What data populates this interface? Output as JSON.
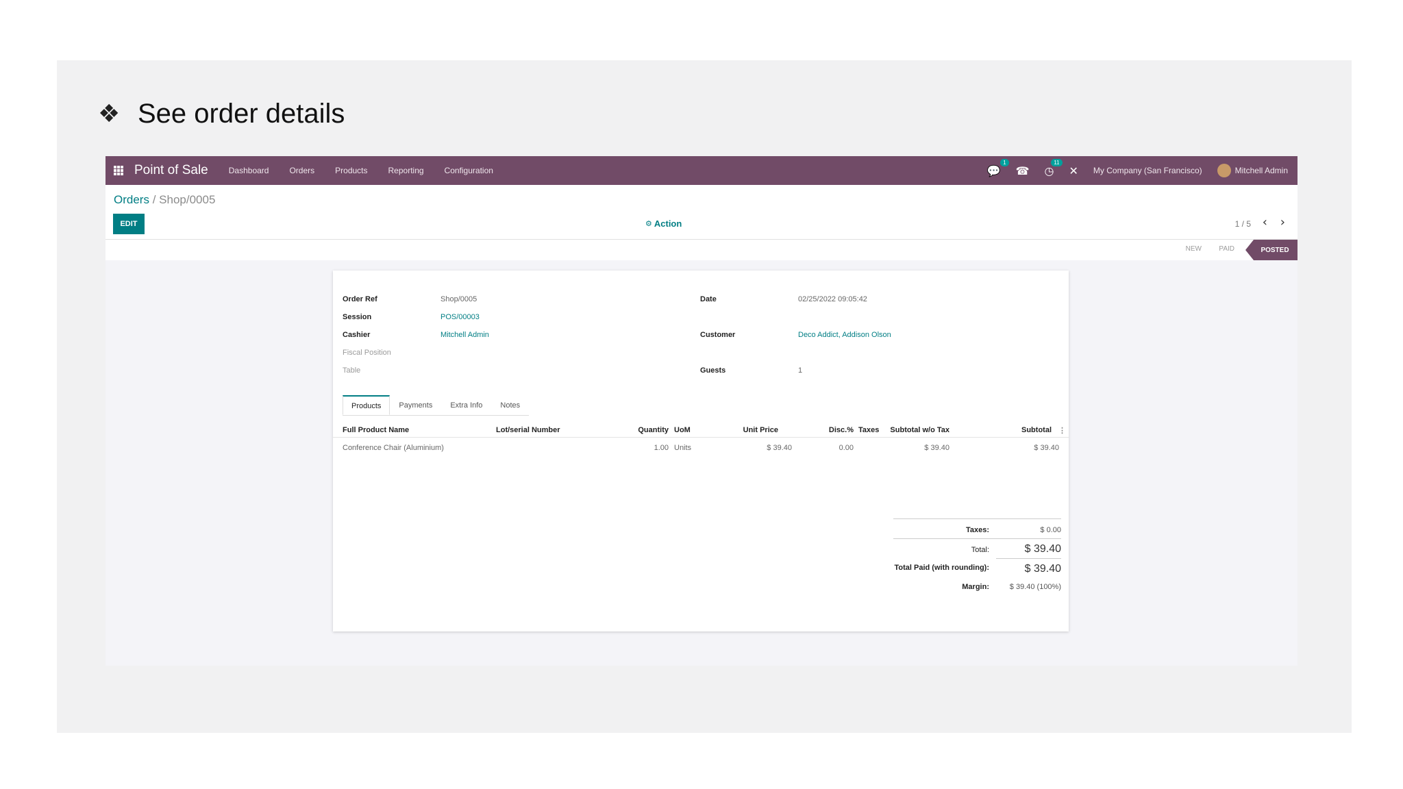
{
  "slide": {
    "bullet": "❖",
    "heading": "See order details"
  },
  "navbar": {
    "app_name": "Point of Sale",
    "menu": [
      "Dashboard",
      "Orders",
      "Products",
      "Reporting",
      "Configuration"
    ],
    "chat_badge": "1",
    "activity_badge": "11",
    "company": "My Company (San Francisco)",
    "user": "Mitchell Admin"
  },
  "breadcrumb": {
    "parent": "Orders",
    "separator": "/",
    "current": "Shop/0005"
  },
  "toolbar": {
    "edit": "EDIT",
    "action": "Action",
    "pager": "1 / 5"
  },
  "status": {
    "steps": [
      "NEW",
      "PAID"
    ],
    "current": "POSTED"
  },
  "form": {
    "order_ref_label": "Order Ref",
    "order_ref": "Shop/0005",
    "session_label": "Session",
    "session": "POS/00003",
    "cashier_label": "Cashier",
    "cashier": "Mitchell Admin",
    "fiscal_label": "Fiscal Position",
    "table_label": "Table",
    "date_label": "Date",
    "date": "02/25/2022 09:05:42",
    "customer_label": "Customer",
    "customer": "Deco Addict, Addison Olson",
    "guests_label": "Guests",
    "guests": "1"
  },
  "tabs": [
    "Products",
    "Payments",
    "Extra Info",
    "Notes"
  ],
  "table": {
    "columns": [
      "Full Product Name",
      "Lot/serial Number",
      "Quantity",
      "UoM",
      "Unit Price",
      "Disc.%",
      "Taxes",
      "Subtotal w/o Tax",
      "Subtotal"
    ],
    "rows": [
      {
        "product": "Conference Chair (Aluminium)",
        "lot": "",
        "qty": "1.00",
        "uom": "Units",
        "price": "$ 39.40",
        "disc": "0.00",
        "taxes": "",
        "subtotal_wo": "$ 39.40",
        "subtotal": "$ 39.40"
      }
    ]
  },
  "totals": {
    "taxes_label": "Taxes:",
    "taxes": "$ 0.00",
    "total_label": "Total:",
    "total": "$ 39.40",
    "paid_label": "Total Paid (with rounding):",
    "paid": "$ 39.40",
    "margin_label": "Margin:",
    "margin": "$ 39.40 (100%)"
  },
  "colors": {
    "brand": "#714b67",
    "accent": "#017e84"
  }
}
